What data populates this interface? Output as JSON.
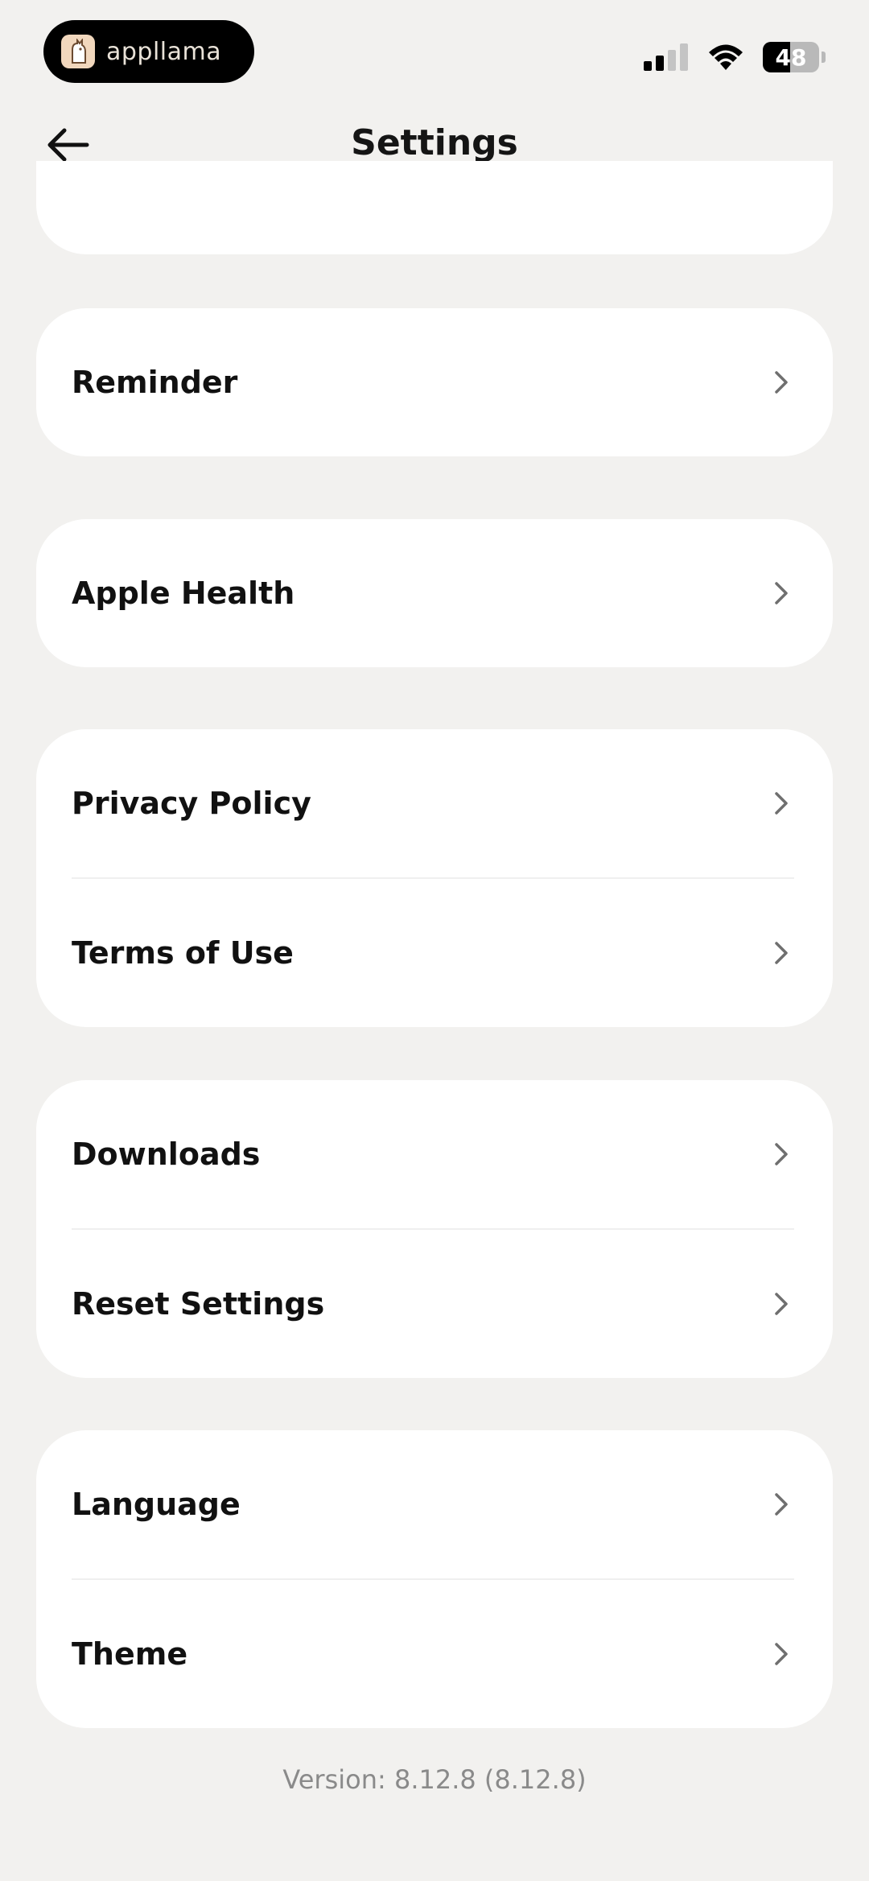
{
  "status_bar": {
    "app_name": "appllama",
    "battery_level": "48",
    "signal_bars": 2,
    "icons": [
      "cellular-signal-icon",
      "wifi-icon",
      "battery-icon"
    ]
  },
  "header": {
    "title": "Settings",
    "back_icon": "arrow-left-icon"
  },
  "groups": [
    {
      "items": [
        {
          "label": "Reminder"
        }
      ]
    },
    {
      "items": [
        {
          "label": "Apple Health"
        }
      ]
    },
    {
      "items": [
        {
          "label": "Privacy Policy"
        },
        {
          "label": "Terms of Use"
        }
      ]
    },
    {
      "items": [
        {
          "label": "Downloads"
        },
        {
          "label": "Reset Settings"
        }
      ]
    },
    {
      "items": [
        {
          "label": "Language"
        },
        {
          "label": "Theme"
        }
      ]
    }
  ],
  "footer": {
    "version": "Version: 8.12.8 (8.12.8)"
  },
  "colors": {
    "background": "#f2f1ef",
    "card": "#ffffff",
    "text": "#111111",
    "muted": "#8a8a8a"
  }
}
